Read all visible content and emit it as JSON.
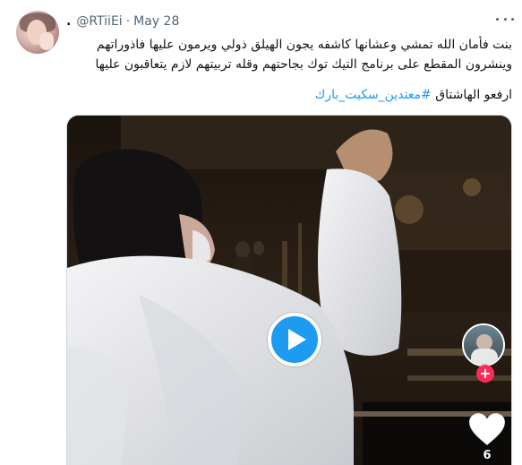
{
  "tweet": {
    "display_name": ".",
    "handle": "@RTiiEi",
    "separator": "·",
    "date": "May 28",
    "text_lines": [
      "بنت فأمان الله تمشي وعشانها كاشفه يجون الهيلق ذولي ويرمون عليها فاذوراتهم",
      "وينشرون المقطع على برنامج التيك توك بجاحتهم وقله تربيتهم لازم يتعاقبون عليها"
    ],
    "cta_text": "ارفعو الهاشتاق",
    "hashtag": "#معتدين_سكيت_بارك"
  },
  "media": {
    "type": "video",
    "like_count": "6",
    "accent_color": "#1d9bf0",
    "follow_color": "#fe2c55",
    "icons": [
      "play-icon",
      "heart-icon",
      "plus-icon",
      "more-icon"
    ]
  }
}
